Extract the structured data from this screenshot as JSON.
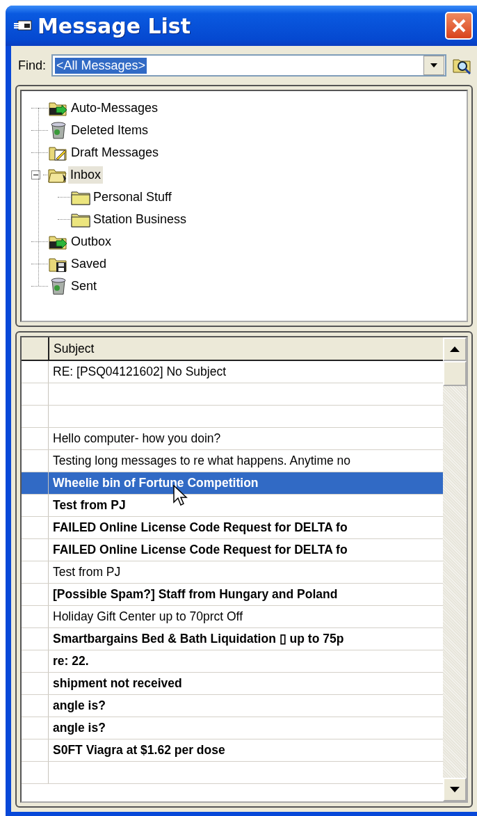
{
  "window": {
    "title": "Message List"
  },
  "find": {
    "label": "Find:",
    "value": "<All Messages>"
  },
  "folders": [
    {
      "name": "Auto-Messages",
      "kind": "outbox",
      "selected": false
    },
    {
      "name": "Deleted Items",
      "kind": "trash",
      "selected": false
    },
    {
      "name": "Draft Messages",
      "kind": "draft",
      "selected": false
    },
    {
      "name": "Inbox",
      "kind": "open",
      "selected": true,
      "expanded": true,
      "children": [
        {
          "name": "Personal Stuff",
          "kind": "folder",
          "selected": false
        },
        {
          "name": "Station Business",
          "kind": "folder",
          "selected": false
        }
      ]
    },
    {
      "name": "Outbox",
      "kind": "outbox",
      "selected": false
    },
    {
      "name": "Saved",
      "kind": "saved",
      "selected": false
    },
    {
      "name": "Sent",
      "kind": "trash",
      "selected": false
    }
  ],
  "table": {
    "columns": [
      "Subject"
    ],
    "rows": [
      {
        "subject": "RE: [PSQ04121602] No Subject",
        "unread": false,
        "selected": false
      },
      {
        "selected": false
      },
      {
        "selected": false
      },
      {
        "subject": "Hello computer- how you doin?",
        "unread": false,
        "selected": false
      },
      {
        "subject": "Testing long messages to re what happens. Anytime no",
        "unread": false,
        "selected": false
      },
      {
        "subject": "Wheelie bin of Fortune Competition",
        "unread": true,
        "selected": true
      },
      {
        "subject": "Test from PJ",
        "unread": true,
        "selected": false
      },
      {
        "subject": "FAILED Online License Code Request for DELTA fo",
        "unread": true,
        "selected": false
      },
      {
        "subject": "FAILED Online License Code Request for DELTA fo",
        "unread": true,
        "selected": false
      },
      {
        "subject": "Test from PJ",
        "unread": false,
        "selected": false
      },
      {
        "subject": "[Possible Spam?] Staff from Hungary and Poland",
        "unread": true,
        "selected": false
      },
      {
        "subject": "Holiday Gift Center up to 70prct Off",
        "unread": false,
        "selected": false
      },
      {
        "subject": "Smartbargains Bed & Bath Liquidation ▯ up to 75p",
        "unread": true,
        "selected": false
      },
      {
        "subject": "re: 22.",
        "unread": true,
        "selected": false
      },
      {
        "subject": "shipment not received",
        "unread": true,
        "selected": false
      },
      {
        "subject": "angle is?",
        "unread": true,
        "selected": false
      },
      {
        "subject": "angle is?",
        "unread": true,
        "selected": false
      },
      {
        "subject": "S0FT Viagra at $1.62 per dose",
        "unread": true,
        "selected": false
      }
    ]
  }
}
